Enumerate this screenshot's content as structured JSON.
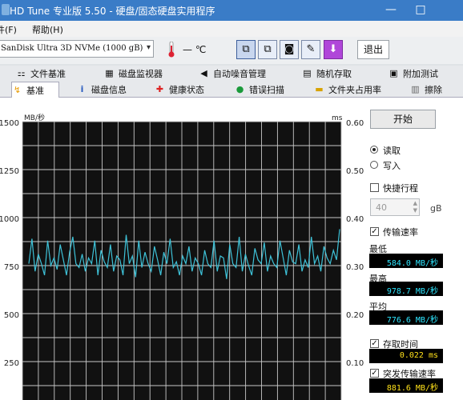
{
  "window": {
    "title": "HD Tune 专业版 5.50 - 硬盘/固态硬盘实用程序",
    "minimize": "—",
    "maximize": "□"
  },
  "menu": [
    {
      "label": "文件(F)"
    },
    {
      "label": "帮助(H)"
    }
  ],
  "toolbar": {
    "drive": "SanDisk Ultra 3D NVMe (1000 gB)",
    "temperature": "— ℃",
    "exit_label": "退出"
  },
  "tabs_row1": [
    {
      "label": "文件基准",
      "icon": "file-benchmark-icon",
      "glyph": "⚏"
    },
    {
      "label": "磁盘监视器",
      "icon": "disk-monitor-icon",
      "glyph": "▦"
    },
    {
      "label": "自动噪音管理",
      "icon": "speaker-icon",
      "glyph": "◀"
    },
    {
      "label": "随机存取",
      "icon": "random-access-icon",
      "glyph": "▤"
    },
    {
      "label": "附加测试",
      "icon": "extra-tests-icon",
      "glyph": "▣"
    }
  ],
  "tabs_row2": [
    {
      "label": "基准",
      "icon": "benchmark-icon",
      "glyph": "↯",
      "active": true
    },
    {
      "label": "磁盘信息",
      "icon": "info-icon",
      "glyph": "i"
    },
    {
      "label": "健康状态",
      "icon": "health-cross-icon",
      "glyph": "✚"
    },
    {
      "label": "错误扫描",
      "icon": "magnifier-icon",
      "glyph": "●"
    },
    {
      "label": "文件夹占用率",
      "icon": "folder-icon",
      "glyph": "▬"
    },
    {
      "label": "擦除",
      "icon": "trash-icon",
      "glyph": "▥"
    }
  ],
  "controls": {
    "start_label": "开始",
    "read_label": "读取",
    "write_label": "写入",
    "mode": "read",
    "short_stroke_label": "快捷行程",
    "short_stroke_checked": false,
    "short_stroke_value": "40",
    "short_stroke_unit": "gB",
    "transfer_rate_label": "传输速率",
    "transfer_rate_checked": true,
    "min_label": "最低",
    "min_value": "584.0 MB/秒",
    "max_label": "最高",
    "max_value": "978.7 MB/秒",
    "avg_label": "平均",
    "avg_value": "776.6 MB/秒",
    "access_time_label": "存取时间",
    "access_time_checked": true,
    "access_time_value": "0.022 ms",
    "burst_rate_label": "突发传输速率",
    "burst_rate_checked": true,
    "burst_rate_value": "881.6 MB/秒",
    "checkmark": "✓"
  },
  "colors": {
    "plot_bg": "#111111",
    "grid": "#c8c8c8",
    "trace": "#3ec2d8",
    "titlebar": "#3a7cc7"
  },
  "chart_data": {
    "type": "line",
    "left_unit": "MB/秒",
    "right_unit": "ms",
    "y_ticks_left": [
      "1500",
      "1250",
      "1000",
      "750",
      "500",
      "250"
    ],
    "y_ticks_right": [
      "0.60",
      "0.50",
      "0.40",
      "0.30",
      "0.20",
      "0.10"
    ],
    "ylim": [
      0,
      1500
    ],
    "x_divisions": 10,
    "grid": true,
    "series": [
      {
        "values": [
          760,
          890,
          720,
          810,
          760,
          700,
          880,
          750,
          790,
          730,
          860,
          780,
          700,
          820,
          900,
          760,
          740,
          810,
          720,
          790,
          760,
          880,
          700,
          830,
          770,
          740,
          860,
          720,
          800,
          780,
          700,
          910,
          760,
          800,
          690,
          880,
          740,
          820,
          760,
          720,
          850,
          780,
          700,
          820,
          760,
          890,
          740,
          770,
          700,
          800,
          760,
          850,
          720,
          790,
          760,
          700,
          830,
          760,
          740,
          880,
          720,
          800,
          790,
          680,
          860,
          760,
          740,
          900,
          720,
          810,
          750,
          700,
          840,
          780,
          760,
          870,
          720,
          800,
          760,
          740,
          880,
          790,
          700,
          830,
          770,
          760,
          860,
          720,
          780,
          740,
          900,
          760,
          800,
          720,
          850,
          790,
          760,
          830,
          780,
          940
        ]
      }
    ]
  }
}
